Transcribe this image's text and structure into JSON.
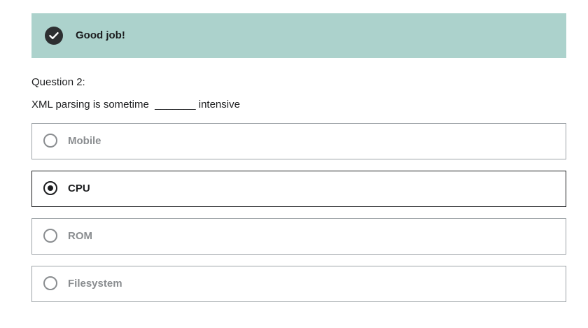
{
  "feedback": {
    "message": "Good job!",
    "icon": "check-circle-icon",
    "color": "#acd2cc"
  },
  "question": {
    "label": "Question 2:",
    "text": "XML parsing is sometime  _______ intensive"
  },
  "options": [
    {
      "label": "Mobile",
      "selected": false
    },
    {
      "label": "CPU",
      "selected": true
    },
    {
      "label": "ROM",
      "selected": false
    },
    {
      "label": "Filesystem",
      "selected": false
    }
  ]
}
